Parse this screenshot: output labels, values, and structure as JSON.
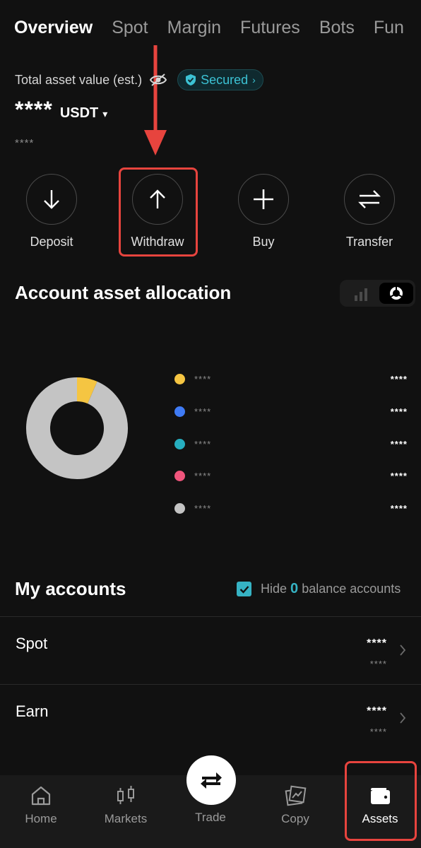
{
  "tabs": [
    "Overview",
    "Spot",
    "Margin",
    "Futures",
    "Bots",
    "Fun"
  ],
  "header": {
    "asset_label": "Total asset value (est.)",
    "secured_label": "Secured",
    "balance_mask": "****",
    "currency": "USDT",
    "sub_mask": "****"
  },
  "actions": [
    {
      "label": "Deposit",
      "icon": "arrow-down-icon"
    },
    {
      "label": "Withdraw",
      "icon": "arrow-up-icon"
    },
    {
      "label": "Buy",
      "icon": "plus-icon"
    },
    {
      "label": "Transfer",
      "icon": "transfer-icon"
    }
  ],
  "allocation": {
    "title": "Account asset allocation",
    "legend": [
      {
        "name": "****",
        "value": "****",
        "color": "#f5c542"
      },
      {
        "name": "****",
        "value": "****",
        "color": "#3f7bf5"
      },
      {
        "name": "****",
        "value": "****",
        "color": "#26aebf"
      },
      {
        "name": "****",
        "value": "****",
        "color": "#f0557c"
      },
      {
        "name": "****",
        "value": "****",
        "color": "#c4c4c4"
      }
    ]
  },
  "chart_data": {
    "type": "pie",
    "categories": [
      "****",
      "****"
    ],
    "values": [
      6.5,
      93.5
    ],
    "colors": [
      "#f5c542",
      "#c4c4c4"
    ]
  },
  "accounts": {
    "title": "My accounts",
    "hide_prefix": "Hide",
    "hide_zero": "0",
    "hide_suffix": "balance accounts",
    "rows": [
      {
        "name": "Spot",
        "value": "****",
        "sub": "****"
      },
      {
        "name": "Earn",
        "value": "****",
        "sub": "****"
      }
    ]
  },
  "nav": {
    "home": "Home",
    "markets": "Markets",
    "trade": "Trade",
    "copy": "Copy",
    "assets": "Assets"
  },
  "colors": {
    "accent": "#36b3c4",
    "highlight": "#e7443e",
    "background": "#111111"
  }
}
